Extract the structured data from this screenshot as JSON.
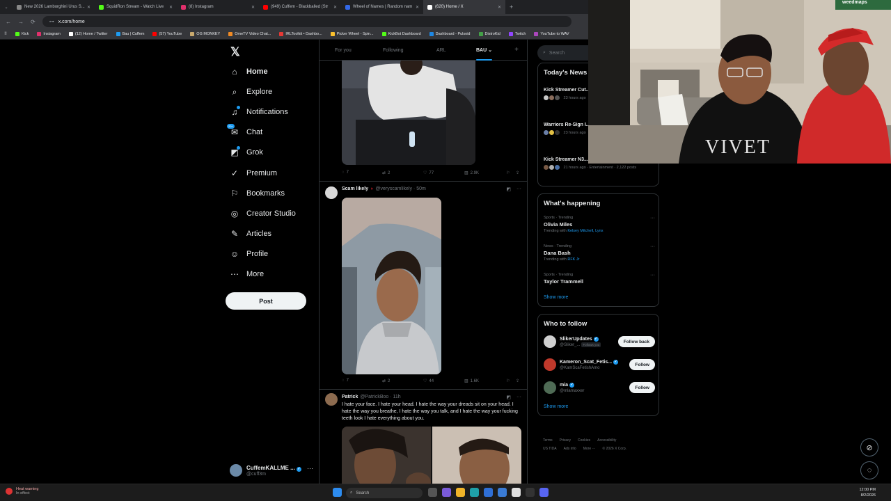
{
  "browser": {
    "tabs": [
      {
        "title": "New 2026 Lamborghini Urus S...",
        "color": "#888888"
      },
      {
        "title": "SquidRon Stream - Watch Live",
        "color": "#53fc18"
      },
      {
        "title": "(8) Instagram",
        "color": "#e1306c"
      },
      {
        "title": "(949) Cuffem - Blackballed (Str",
        "color": "#ff0000"
      },
      {
        "title": "Wheel of Names | Random nam",
        "color": "#3369e8"
      },
      {
        "title": "(620) Home / X",
        "color": "#ffffff"
      }
    ],
    "url": "x.com/home",
    "bookmarks": [
      {
        "label": "Kick",
        "color": "#53fc18"
      },
      {
        "label": "Instagram",
        "color": "#e1306c"
      },
      {
        "label": "(12) Home / Twitter",
        "color": "#ffffff"
      },
      {
        "label": "Bau | Cuffem",
        "color": "#1d9bf0"
      },
      {
        "label": "(57) YouTube",
        "color": "#ff0000"
      },
      {
        "label": "OG MONKEY",
        "color": "#c9a96e"
      },
      {
        "label": "OmeTV Video Chat...",
        "color": "#f08a24"
      },
      {
        "label": "IRLToolkit • Dashbo...",
        "color": "#e53935"
      },
      {
        "label": "Picker Wheel - Spin...",
        "color": "#fbc02d"
      },
      {
        "label": "KickBot Dashboard",
        "color": "#53fc18"
      },
      {
        "label": "Dashboard - Pulsoid",
        "color": "#1e88e5"
      },
      {
        "label": "DistroKid",
        "color": "#43a047"
      },
      {
        "label": "Twitch",
        "color": "#9146ff"
      },
      {
        "label": "YouTube to WAV",
        "color": "#ab47bc"
      }
    ]
  },
  "sidebar": {
    "items": [
      {
        "label": "Home",
        "icon": "home-icon",
        "glyph": "⌂"
      },
      {
        "label": "Explore",
        "icon": "search-icon",
        "glyph": "⌕"
      },
      {
        "label": "Notifications",
        "icon": "bell-icon",
        "glyph": "♫"
      },
      {
        "label": "Chat",
        "icon": "chat-icon",
        "glyph": "✉"
      },
      {
        "label": "Grok",
        "icon": "grok-icon",
        "glyph": "◩"
      },
      {
        "label": "Premium",
        "icon": "premium-icon",
        "glyph": "✓"
      },
      {
        "label": "Bookmarks",
        "icon": "bookmark-icon",
        "glyph": "⚐"
      },
      {
        "label": "Creator Studio",
        "icon": "creator-studio-icon",
        "glyph": "◎"
      },
      {
        "label": "Articles",
        "icon": "articles-icon",
        "glyph": "✎"
      },
      {
        "label": "Profile",
        "icon": "profile-icon",
        "glyph": "☺"
      },
      {
        "label": "More",
        "icon": "more-icon",
        "glyph": "⋯"
      }
    ],
    "chat_badge": "20+",
    "post_label": "Post",
    "account": {
      "name": "CuffemKALLME ...",
      "handle": "@cuff3m"
    }
  },
  "feed": {
    "tabs": [
      "For you",
      "Following",
      "ARL",
      "BAU"
    ],
    "active_tab": "BAU",
    "posts": [
      {
        "replies": "7",
        "reposts": "2",
        "likes": "77",
        "views": "2.9K"
      },
      {
        "name": "Scam likely",
        "handle": "@veryscamlikely · 50m",
        "replies": "7",
        "reposts": "2",
        "likes": "44",
        "views": "1.6K"
      },
      {
        "name": "Patrick",
        "handle": "@PatrickBoo · 11h",
        "text": "I hate your face. I hate your head. I hate the way your dreads sit on your head. I hate the way you breathe, I hate the way you talk, and I hate the way your fucking teeth look I hate everything about you."
      }
    ]
  },
  "right": {
    "search_placeholder": "Search",
    "news_title": "Today's News",
    "news": [
      {
        "title": "Kick Streamer Cut... Secret Contact an...",
        "meta": "23 hours ago"
      },
      {
        "title": "Warriors Re-Sign I... Bolster Backcourt...",
        "meta": "23 hours ago"
      },
      {
        "title": "Kick Streamer N3... Hits Woman at Caribana",
        "meta": "21 hours ago · Entertainment · 2,122 posts"
      }
    ],
    "happening_title": "What's happening",
    "trends": [
      {
        "category": "Sports · Trending",
        "name": "Olivia Miles",
        "sub_prefix": "Trending with",
        "sub_link": "Kelsey Mitchell, Lynx"
      },
      {
        "category": "News · Trending",
        "name": "Dana Bash",
        "sub_prefix": "Trending with",
        "sub_link": "RFK Jr"
      },
      {
        "category": "Sports · Trending",
        "name": "Taylor Trammell",
        "sub_prefix": "",
        "sub_link": ""
      }
    ],
    "show_more": "Show more",
    "follow_title": "Who to follow",
    "follow": [
      {
        "name": "SlikerUpdates",
        "handle": "@Sliker_...",
        "follows_you": "Follows you",
        "button": "Follow back"
      },
      {
        "name": "Kameron_Scat_Fetis...",
        "handle": "@KamScaFetishAmo",
        "follows_you": "",
        "button": "Follow"
      },
      {
        "name": "mia",
        "handle": "@mlamaxxer",
        "follows_you": "",
        "button": "Follow"
      }
    ],
    "footer_line1": [
      "Terms",
      "Privacy",
      "Cookies",
      "Accessibility"
    ],
    "footer_line2": [
      "US TIDA",
      "Ads info",
      "More ···",
      "© 2026 X Corp."
    ]
  },
  "webcam": {
    "overlay_logo": "weedmaps",
    "shirt_text": "VIVET"
  },
  "taskbar": {
    "weather_title": "Heat warning",
    "weather_sub": "In effect",
    "search": "Search",
    "time": "12:00 PM",
    "date": "8/2/2026"
  }
}
